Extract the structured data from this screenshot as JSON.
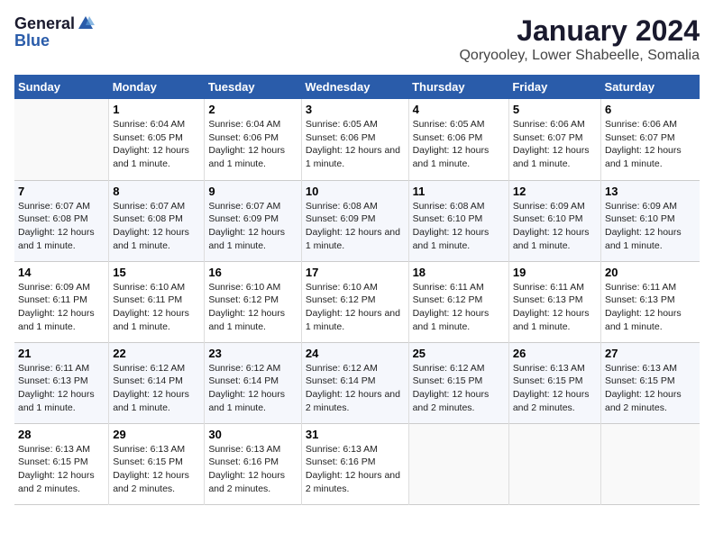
{
  "logo": {
    "general": "General",
    "blue": "Blue"
  },
  "title": "January 2024",
  "subtitle": "Qoryooley, Lower Shabeelle, Somalia",
  "days_of_week": [
    "Sunday",
    "Monday",
    "Tuesday",
    "Wednesday",
    "Thursday",
    "Friday",
    "Saturday"
  ],
  "weeks": [
    [
      {
        "day": "",
        "sunrise": "",
        "sunset": "",
        "daylight": ""
      },
      {
        "day": "1",
        "sunrise": "6:04 AM",
        "sunset": "6:05 PM",
        "daylight": "12 hours and 1 minute."
      },
      {
        "day": "2",
        "sunrise": "6:04 AM",
        "sunset": "6:06 PM",
        "daylight": "12 hours and 1 minute."
      },
      {
        "day": "3",
        "sunrise": "6:05 AM",
        "sunset": "6:06 PM",
        "daylight": "12 hours and 1 minute."
      },
      {
        "day": "4",
        "sunrise": "6:05 AM",
        "sunset": "6:06 PM",
        "daylight": "12 hours and 1 minute."
      },
      {
        "day": "5",
        "sunrise": "6:06 AM",
        "sunset": "6:07 PM",
        "daylight": "12 hours and 1 minute."
      },
      {
        "day": "6",
        "sunrise": "6:06 AM",
        "sunset": "6:07 PM",
        "daylight": "12 hours and 1 minute."
      }
    ],
    [
      {
        "day": "7",
        "sunrise": "6:07 AM",
        "sunset": "6:08 PM",
        "daylight": "12 hours and 1 minute."
      },
      {
        "day": "8",
        "sunrise": "6:07 AM",
        "sunset": "6:08 PM",
        "daylight": "12 hours and 1 minute."
      },
      {
        "day": "9",
        "sunrise": "6:07 AM",
        "sunset": "6:09 PM",
        "daylight": "12 hours and 1 minute."
      },
      {
        "day": "10",
        "sunrise": "6:08 AM",
        "sunset": "6:09 PM",
        "daylight": "12 hours and 1 minute."
      },
      {
        "day": "11",
        "sunrise": "6:08 AM",
        "sunset": "6:10 PM",
        "daylight": "12 hours and 1 minute."
      },
      {
        "day": "12",
        "sunrise": "6:09 AM",
        "sunset": "6:10 PM",
        "daylight": "12 hours and 1 minute."
      },
      {
        "day": "13",
        "sunrise": "6:09 AM",
        "sunset": "6:10 PM",
        "daylight": "12 hours and 1 minute."
      }
    ],
    [
      {
        "day": "14",
        "sunrise": "6:09 AM",
        "sunset": "6:11 PM",
        "daylight": "12 hours and 1 minute."
      },
      {
        "day": "15",
        "sunrise": "6:10 AM",
        "sunset": "6:11 PM",
        "daylight": "12 hours and 1 minute."
      },
      {
        "day": "16",
        "sunrise": "6:10 AM",
        "sunset": "6:12 PM",
        "daylight": "12 hours and 1 minute."
      },
      {
        "day": "17",
        "sunrise": "6:10 AM",
        "sunset": "6:12 PM",
        "daylight": "12 hours and 1 minute."
      },
      {
        "day": "18",
        "sunrise": "6:11 AM",
        "sunset": "6:12 PM",
        "daylight": "12 hours and 1 minute."
      },
      {
        "day": "19",
        "sunrise": "6:11 AM",
        "sunset": "6:13 PM",
        "daylight": "12 hours and 1 minute."
      },
      {
        "day": "20",
        "sunrise": "6:11 AM",
        "sunset": "6:13 PM",
        "daylight": "12 hours and 1 minute."
      }
    ],
    [
      {
        "day": "21",
        "sunrise": "6:11 AM",
        "sunset": "6:13 PM",
        "daylight": "12 hours and 1 minute."
      },
      {
        "day": "22",
        "sunrise": "6:12 AM",
        "sunset": "6:14 PM",
        "daylight": "12 hours and 1 minute."
      },
      {
        "day": "23",
        "sunrise": "6:12 AM",
        "sunset": "6:14 PM",
        "daylight": "12 hours and 1 minute."
      },
      {
        "day": "24",
        "sunrise": "6:12 AM",
        "sunset": "6:14 PM",
        "daylight": "12 hours and 2 minutes."
      },
      {
        "day": "25",
        "sunrise": "6:12 AM",
        "sunset": "6:15 PM",
        "daylight": "12 hours and 2 minutes."
      },
      {
        "day": "26",
        "sunrise": "6:13 AM",
        "sunset": "6:15 PM",
        "daylight": "12 hours and 2 minutes."
      },
      {
        "day": "27",
        "sunrise": "6:13 AM",
        "sunset": "6:15 PM",
        "daylight": "12 hours and 2 minutes."
      }
    ],
    [
      {
        "day": "28",
        "sunrise": "6:13 AM",
        "sunset": "6:15 PM",
        "daylight": "12 hours and 2 minutes."
      },
      {
        "day": "29",
        "sunrise": "6:13 AM",
        "sunset": "6:15 PM",
        "daylight": "12 hours and 2 minutes."
      },
      {
        "day": "30",
        "sunrise": "6:13 AM",
        "sunset": "6:16 PM",
        "daylight": "12 hours and 2 minutes."
      },
      {
        "day": "31",
        "sunrise": "6:13 AM",
        "sunset": "6:16 PM",
        "daylight": "12 hours and 2 minutes."
      },
      {
        "day": "",
        "sunrise": "",
        "sunset": "",
        "daylight": ""
      },
      {
        "day": "",
        "sunrise": "",
        "sunset": "",
        "daylight": ""
      },
      {
        "day": "",
        "sunrise": "",
        "sunset": "",
        "daylight": ""
      }
    ]
  ],
  "labels": {
    "sunrise_prefix": "Sunrise: ",
    "sunset_prefix": "Sunset: ",
    "daylight_prefix": "Daylight: "
  }
}
